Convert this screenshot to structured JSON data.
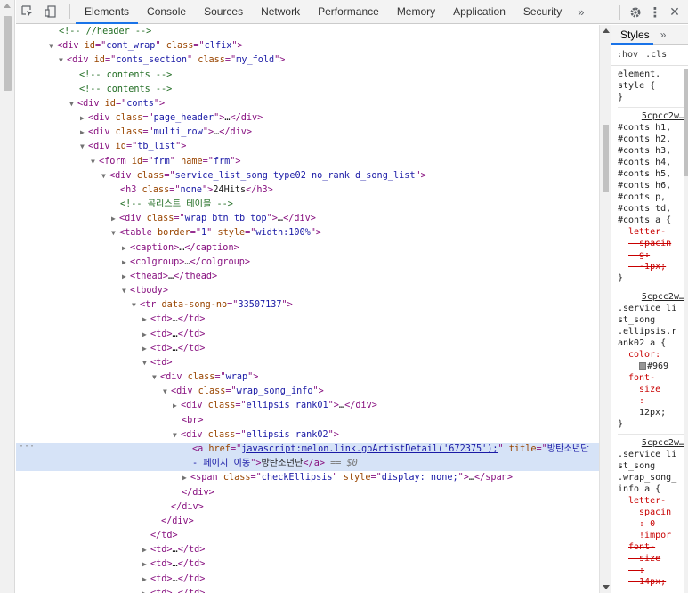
{
  "toolbar": {
    "tabs": [
      "Elements",
      "Console",
      "Sources",
      "Network",
      "Performance",
      "Memory",
      "Application",
      "Security"
    ],
    "more": "»",
    "kebab": "⋮",
    "close": "✕"
  },
  "tree": {
    "l1_comment": "<!-- //header -->",
    "l2_id": "cont_wrap",
    "l2_class": "clfix",
    "l3_id": "conts_section",
    "l3_class": "my_fold",
    "l4_comment": "<!-- contents -->",
    "l5_comment": "<!-- contents -->",
    "l6_id": "conts",
    "l7_class": "page_header",
    "l8_class": "multi_row",
    "l9_id": "tb_list",
    "l10_id": "frm",
    "l10_name": "frm",
    "l11_class": "service_list_song type02 no_rank d_song_list",
    "l12_class": "none",
    "l12_text": "24Hits",
    "l13_comment": "<!-- 곡리스트 테이블 -->",
    "l14_class": "wrap_btn_tb top",
    "l15_border": "1",
    "l15_style": "width:100%",
    "l16": "caption",
    "l17": "colgroup",
    "l18": "thead",
    "l19": "tbody",
    "l20_song_no": "33507137",
    "l25_class": "wrap",
    "l26_class": "wrap_song_info",
    "l27_class": "ellipsis rank01",
    "l29_class": "ellipsis rank02",
    "sel_href": "javascript:melon.link.goArtistDetail('672375');",
    "sel_title": "방탄소년단 - 페이지 이동",
    "sel_text": "방탄소년단",
    "sel_eq": "== $0",
    "l31_class": "checkEllipsis",
    "l31_style": "display: none;"
  },
  "styles": {
    "tab": "Styles",
    "more": "»",
    "filter_hov": ":hov",
    "filter_cls": ".cls",
    "rule1_selector": "element.\nstyle {",
    "rule2_src": "5cpcc2w…",
    "rule2_selector": "#conts h1,\n#conts h2,\n#conts h3,\n#conts h4,\n#conts h5,\n#conts h6,\n#conts p,\n#conts td,\n#conts a {",
    "rule2_prop": "letter-\n  spacin\n  g:\n  -1px;",
    "rule3_src": "5cpcc2w…",
    "rule3_selector": ".service_li\nst_song\n.ellipsis.r\nank02 a {",
    "rule3_color_prop": "color:",
    "rule3_color_val": "#969",
    "rule3_fs_prop": "font-\n  size\n  :",
    "rule3_fs_val": "12px;",
    "rule4_src": "5cpcc2w…",
    "rule4_selector": ".service_li\nst_song\n.wrap_song_\ninfo a {",
    "rule4_prop": "letter-\n  spacin\n  : 0\n  !impor",
    "rule4_prop2": "font-\n  size\n  :\n  14px;"
  }
}
